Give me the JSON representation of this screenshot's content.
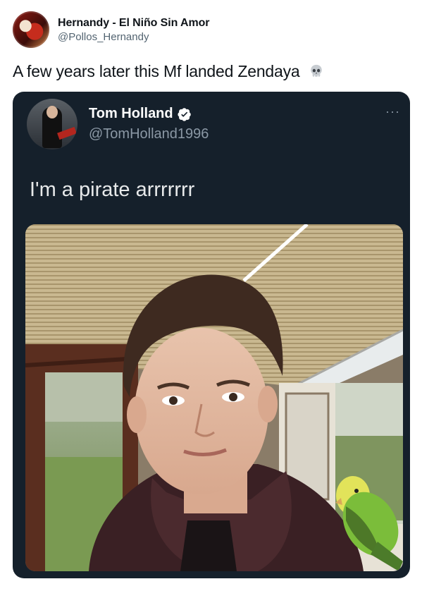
{
  "outer_tweet": {
    "name": "Hernandy - El Niño Sin Amor",
    "handle": "@Pollos_Hernandy",
    "text": "A few years later this Mf landed Zendaya"
  },
  "quoted_tweet": {
    "name": "Tom Holland",
    "handle": "@TomHolland1996",
    "text": "I'm a pirate arrrrrrr",
    "more_label": "···"
  },
  "colors": {
    "card_bg": "#15202b",
    "verified_blue": "#ffffff"
  },
  "icons": {
    "emoji": "skull-icon",
    "verified": "verified-badge-icon",
    "more": "more-options-icon"
  }
}
